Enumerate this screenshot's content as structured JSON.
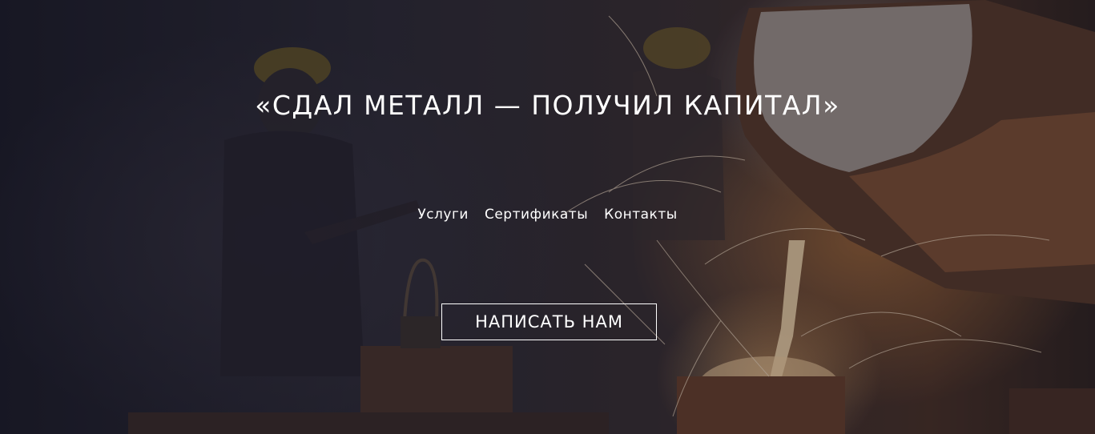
{
  "hero": {
    "background_description_icon": "foundry-pouring-molten-metal-image",
    "headline": "«СДАЛ МЕТАЛЛ — ПОЛУЧИЛ КАПИТАЛ»",
    "nav": [
      {
        "label": "Услуги"
      },
      {
        "label": "Сертификаты"
      },
      {
        "label": "Контакты"
      }
    ],
    "cta_label": "НАПИСАТЬ НАМ",
    "colors": {
      "text": "#ffffff",
      "overlay": "#14142a",
      "molten": "#f0a050"
    }
  }
}
